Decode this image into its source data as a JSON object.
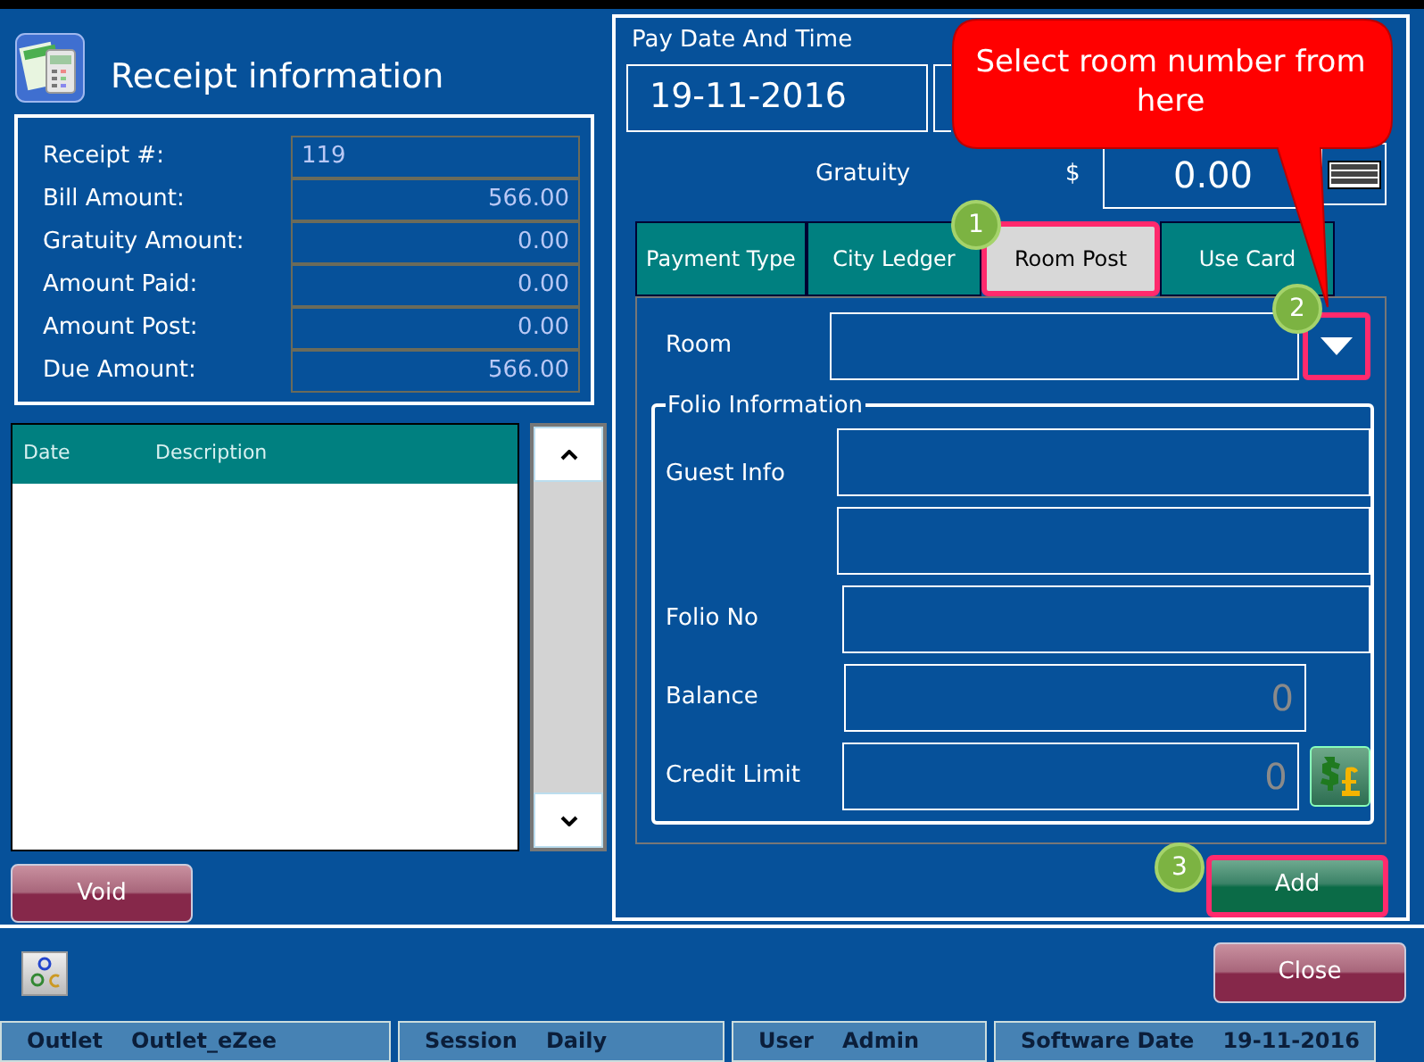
{
  "header": {
    "title": "Receipt information"
  },
  "receipt_summary": [
    {
      "label": "Receipt #:",
      "value": "119"
    },
    {
      "label": "Bill Amount:",
      "value": "566.00"
    },
    {
      "label": "Gratuity Amount:",
      "value": "0.00"
    },
    {
      "label": "Amount Paid:",
      "value": "0.00"
    },
    {
      "label": "Amount Post:",
      "value": "0.00"
    },
    {
      "label": "Due Amount:",
      "value": "566.00"
    }
  ],
  "transactions": {
    "columns": [
      "Date",
      "Description"
    ]
  },
  "void_button": "Void",
  "payment": {
    "pay_date_label": "Pay Date And Time",
    "date": "19-11-2016",
    "gratuity_label": "Gratuity",
    "currency": "$",
    "gratuity_value": "0.00"
  },
  "tabs": [
    {
      "label": "Payment Type",
      "selected": false
    },
    {
      "label": "City Ledger",
      "selected": false
    },
    {
      "label": "Room Post",
      "selected": true
    },
    {
      "label": "Use Card",
      "selected": false
    }
  ],
  "room_post": {
    "room_label": "Room",
    "folio_title": "Folio Information",
    "fields": [
      {
        "label": "Guest Info",
        "kind": "double"
      },
      {
        "label": "Folio No",
        "kind": "text"
      },
      {
        "label": "Balance",
        "kind": "amount",
        "value": "0"
      },
      {
        "label": "Credit Limit",
        "kind": "amount_button",
        "value": "0"
      }
    ]
  },
  "add_button": "Add",
  "close_button": "Close",
  "status_bar": [
    {
      "label": "Outlet",
      "value": "Outlet_eZee"
    },
    {
      "label": "Session",
      "value": "Daily"
    },
    {
      "label": "User",
      "value": "Admin"
    },
    {
      "label": "Software Date",
      "value": "19-11-2016"
    }
  ],
  "annotations": {
    "callout": "Select room number from here",
    "steps": [
      "1",
      "2",
      "3"
    ]
  }
}
